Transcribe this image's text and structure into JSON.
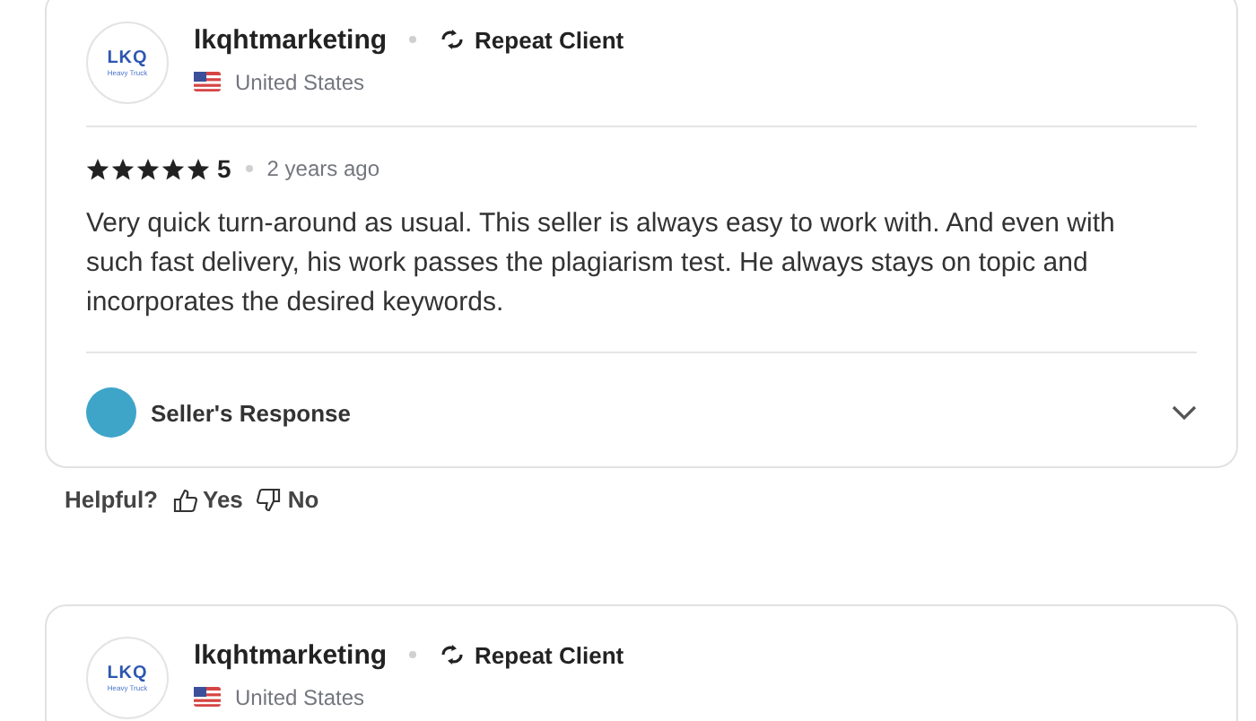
{
  "reviews": [
    {
      "logo": {
        "brand": "LKQ",
        "sub": "Heavy Truck"
      },
      "username": "lkqhtmarketing",
      "badge": "Repeat Client",
      "country": "United States",
      "stars": 5,
      "rating": "5",
      "time": "2 years ago",
      "text": "Very quick turn-around as usual. This seller is always easy to work with. And even with such fast delivery, his work passes the plagiarism test. He always stays on topic and incorporates the desired keywords.",
      "response": {
        "label": "Seller's Response",
        "expanded": false
      },
      "helpful": {
        "label": "Helpful?",
        "yes": "Yes",
        "no": "No"
      }
    },
    {
      "logo": {
        "brand": "LKQ",
        "sub": "Heavy Truck"
      },
      "username": "lkqhtmarketing",
      "badge": "Repeat Client",
      "country": "United States"
    }
  ]
}
